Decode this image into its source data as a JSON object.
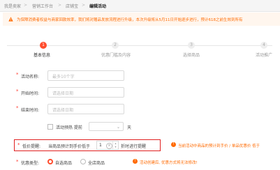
{
  "breadcrumb": {
    "items": [
      "我是卖家",
      "营销工作台",
      "店铺宝",
      "编辑活动"
    ]
  },
  "notice": {
    "text": "为保障消费者权益与商家回款效率，我们将对赠品发放流程进行升级，本次升级将从5月11日开始逐步进行，预计618之前生效到所有"
  },
  "steps": [
    {
      "number": "1",
      "label": "基本信息"
    },
    {
      "number": "2",
      "label": "优惠门槛及内容"
    },
    {
      "number": "3",
      "label": "选择商品"
    },
    {
      "number": "4",
      "label": "活动推广"
    }
  ],
  "form": {
    "name": {
      "label": "活动名称:",
      "placeholder": "最多10个字"
    },
    "start": {
      "label": "开始时间:",
      "placeholder": "请选择日期"
    },
    "end": {
      "label": "结束时间:",
      "placeholder": "请选择日期"
    },
    "preheat": {
      "checkbox_label": "活动预热 提前",
      "unit": "天"
    },
    "low_price": {
      "label": "低价提醒:",
      "text_before": "当商品预计到手价低于",
      "value": "1",
      "text_after": "折时进行提醒",
      "hint": "当前活动中商品的预计到手价 / 单品优惠价 低于"
    },
    "discount_type": {
      "label": "优惠类型:",
      "options": [
        "自选商品",
        "全店商品"
      ],
      "selected_index": 0,
      "hint": "活动创建后, 优惠方式将无法修改!"
    }
  },
  "colors": {
    "accent": "#ff4d2e",
    "warning": "#ff6a00",
    "highlight_border": "#e02020"
  }
}
